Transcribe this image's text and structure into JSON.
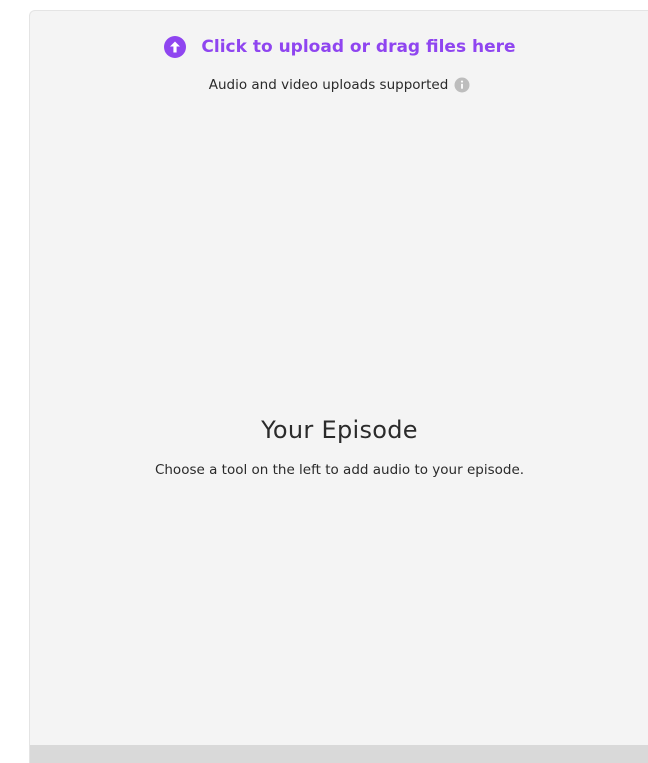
{
  "upload": {
    "label": "Click to upload or drag files here",
    "supported_text": "Audio and video uploads supported",
    "icon": "upload-arrow-icon",
    "info_icon": "info-icon",
    "accent_color": "#8f45f0"
  },
  "episode": {
    "title": "Your Episode",
    "hint": "Choose a tool on the left to add audio to your episode."
  }
}
